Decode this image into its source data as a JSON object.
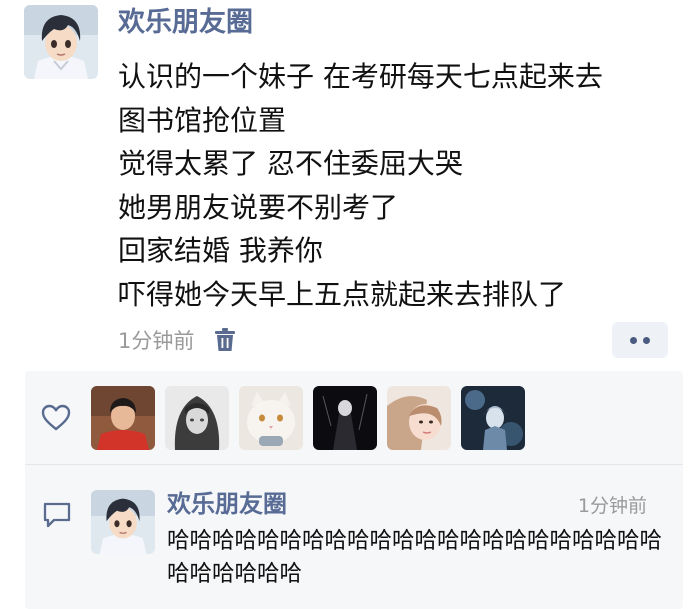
{
  "post": {
    "author": "欢乐朋友圈",
    "content_lines": [
      "认识的一个妹子 在考研每天七点起来去",
      "图书馆抢位置",
      "觉得太累了 忍不住委屈大哭",
      "她男朋友说要不别考了",
      "回家结婚 我养你",
      "吓得她今天早上五点就起来去排队了"
    ],
    "timestamp": "1分钟前"
  },
  "icons": {
    "delete": "trash-icon",
    "more": "more-dots-icon",
    "like": "heart-icon",
    "comment": "comment-bubble-icon"
  },
  "likes": {
    "avatar_count": 6
  },
  "comment": {
    "author": "欢乐朋友圈",
    "time": "1分钟前",
    "text": "哈哈哈哈哈哈哈哈哈哈哈哈哈哈哈哈哈哈哈哈哈哈哈哈哈哈哈哈"
  },
  "colors": {
    "link_blue": "#576b95",
    "meta_gray": "#9a9a9a",
    "panel_bg": "#f6f7f9"
  }
}
